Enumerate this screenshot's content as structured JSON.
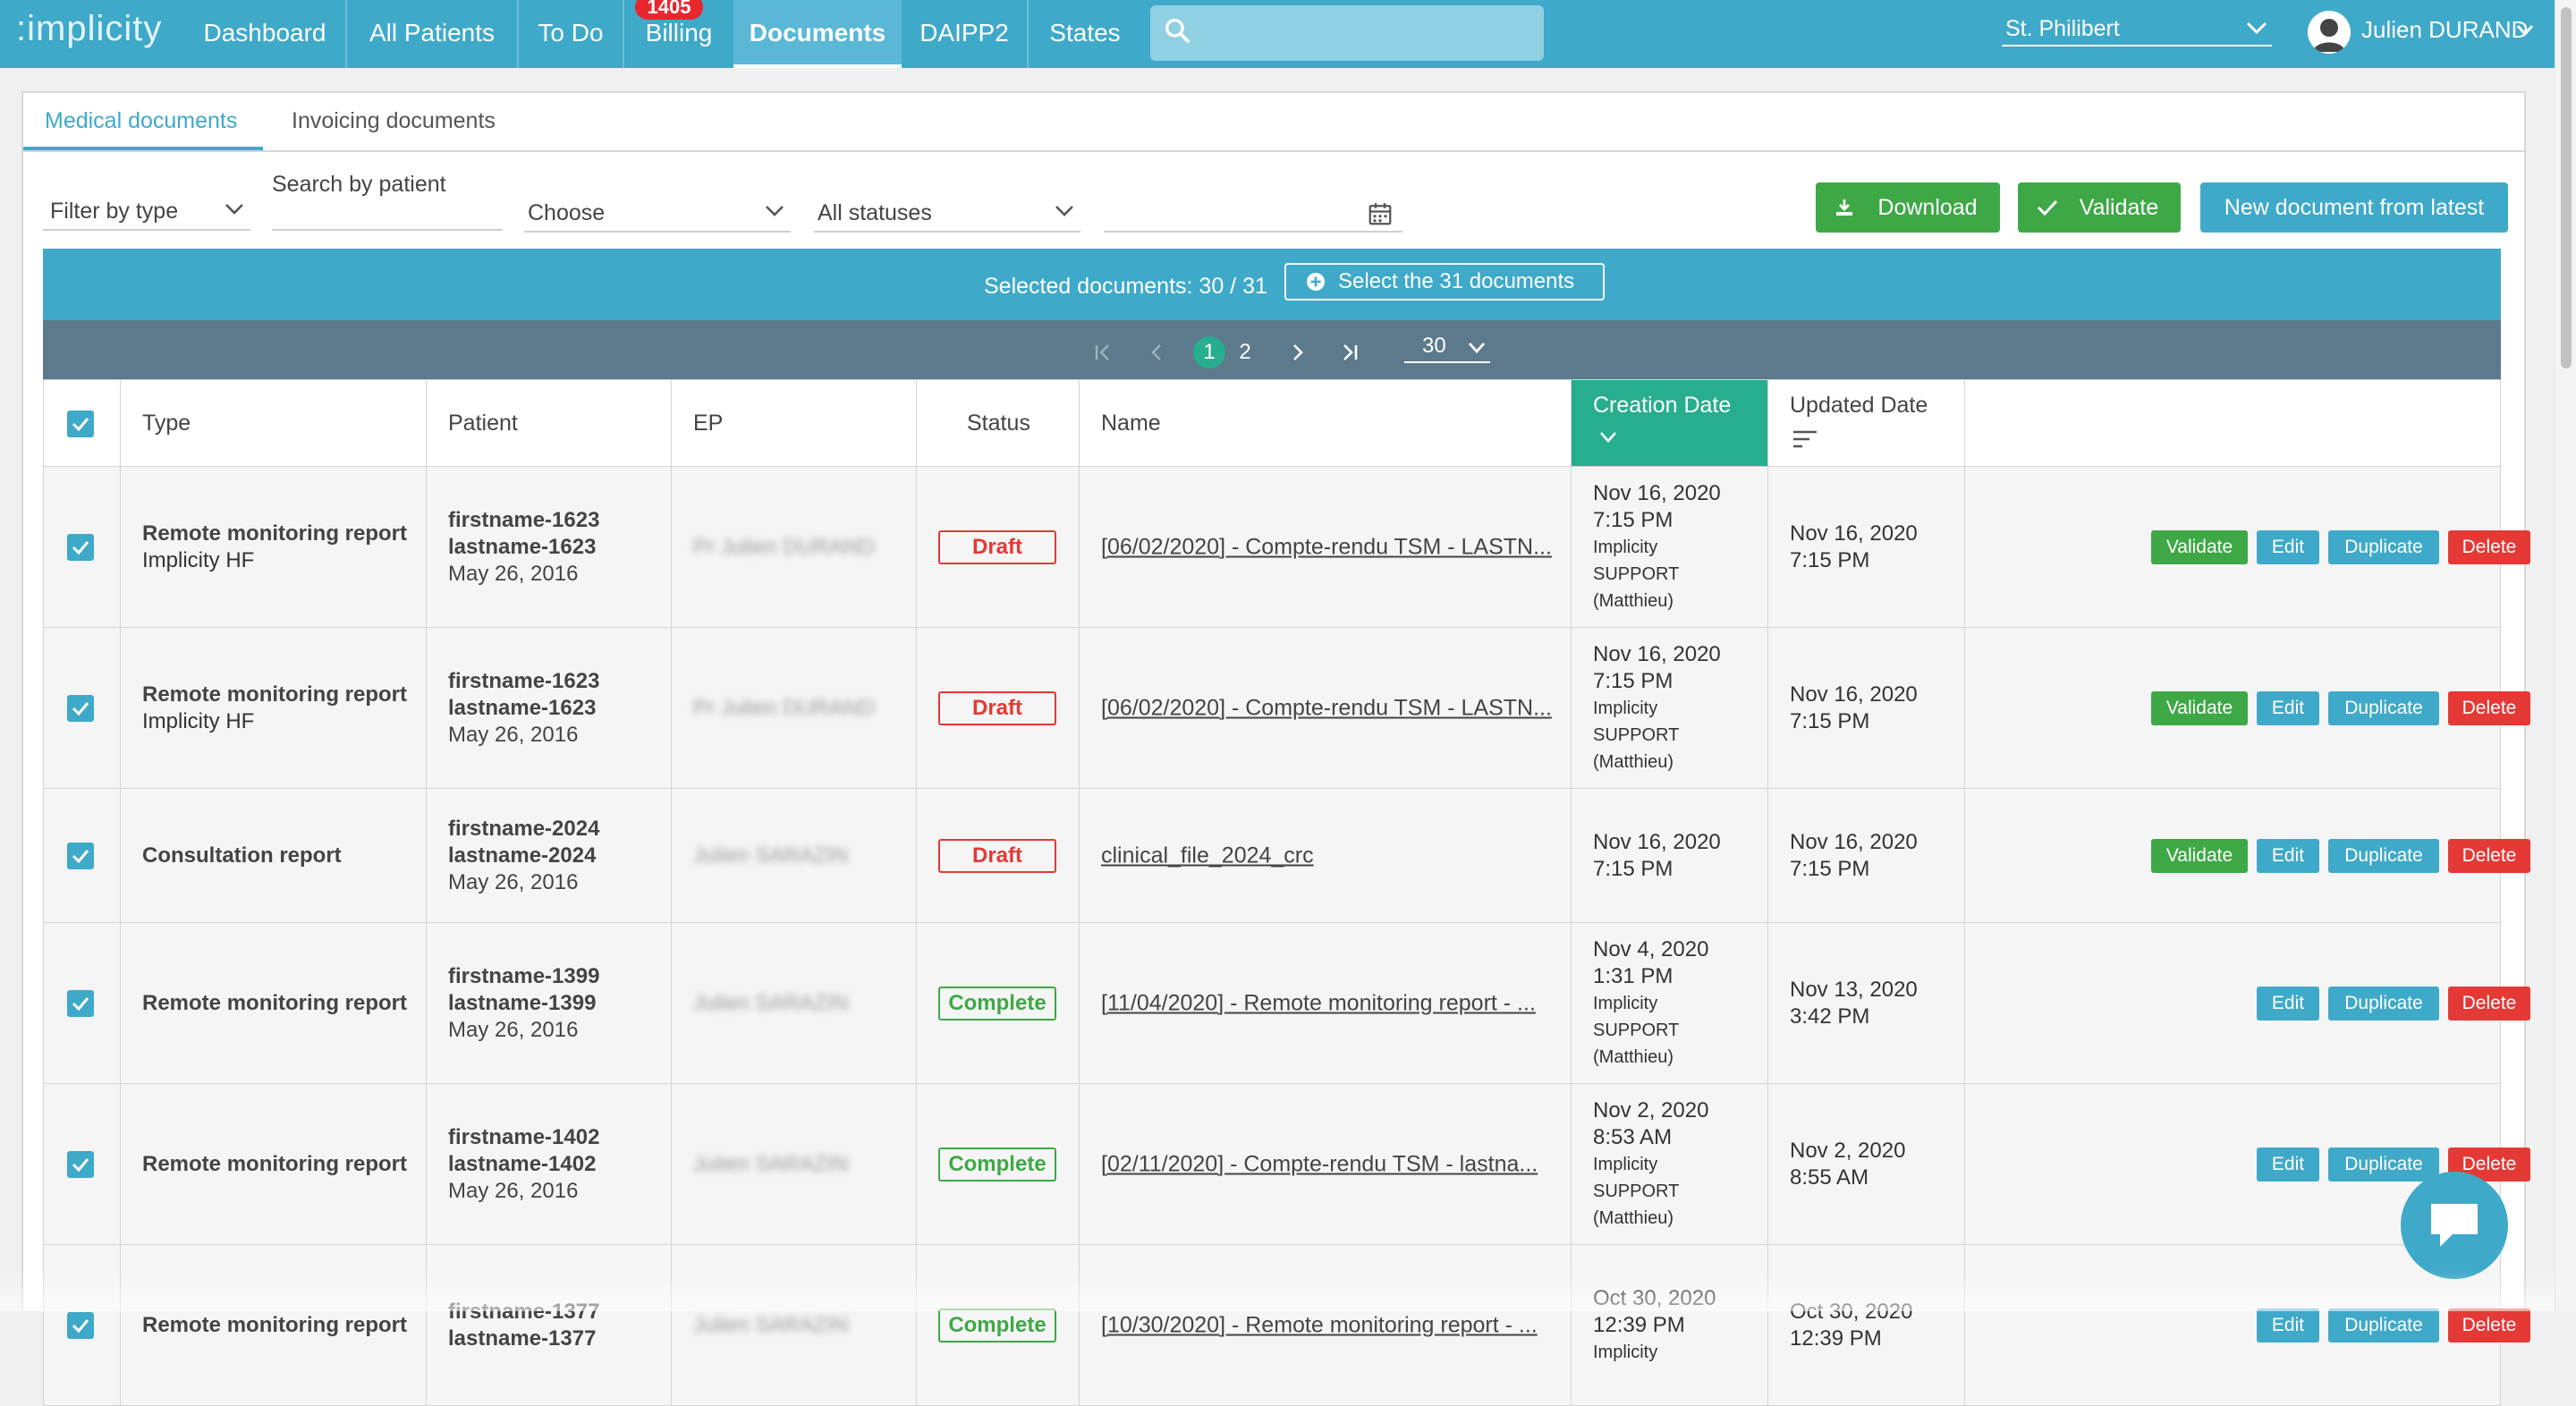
{
  "nav": {
    "logo": ":implicity",
    "items": [
      "Dashboard",
      "All Patients",
      "To Do",
      "Billing",
      "Documents",
      "DAIPP2",
      "States"
    ],
    "billing_badge": "1405",
    "search_placeholder": "",
    "site": "St. Philibert",
    "user": "Julien DURAND",
    "icons": [
      "search-icon",
      "chevron-down-icon",
      "avatar",
      "chevron-down-icon"
    ]
  },
  "tabs": [
    "Medical documents",
    "Invoicing documents"
  ],
  "filters": {
    "type": "Filter by type",
    "patient_label": "Search by patient",
    "patient_value": "",
    "choose": "Choose",
    "statuses": "All statuses",
    "date_value": ""
  },
  "actions": {
    "download": "Download",
    "validate": "Validate",
    "new_document": "New document from latest"
  },
  "selection": {
    "text": "Selected documents: 30 / 31",
    "select_all": "Select the 31 documents"
  },
  "pager": {
    "pages": [
      "1",
      "2"
    ],
    "current": "1",
    "page_size": "30"
  },
  "table": {
    "headers": {
      "type": "Type",
      "patient": "Patient",
      "ep": "EP",
      "status": "Status",
      "name": "Name",
      "creation": "Creation Date",
      "updated": "Updated Date"
    },
    "buttons": {
      "validate": "Validate",
      "edit": "Edit",
      "duplicate": "Duplicate",
      "delete": "Delete"
    },
    "rows": [
      {
        "type": "Remote monitoring report",
        "subtype": "Implicity HF",
        "patient1": "firstname-1623",
        "patient2": "lastname-1623",
        "patient3": "May 26, 2016",
        "ep": "Pr Julien DURAND",
        "status": "Draft",
        "name": "[06/02/2020] - Compte-rendu TSM - LASTN...",
        "created1": "Nov 16, 2020",
        "created2": "7:15 PM",
        "by1": "Implicity",
        "by2": "SUPPORT",
        "by3": "(Matthieu)",
        "updated1": "Nov 16, 2020",
        "updated2": "7:15 PM",
        "validatable": true
      },
      {
        "type": "Remote monitoring report",
        "subtype": "Implicity HF",
        "patient1": "firstname-1623",
        "patient2": "lastname-1623",
        "patient3": "May 26, 2016",
        "ep": "Pr Julien DURAND",
        "status": "Draft",
        "name": "[06/02/2020] - Compte-rendu TSM - LASTN...",
        "created1": "Nov 16, 2020",
        "created2": "7:15 PM",
        "by1": "Implicity",
        "by2": "SUPPORT",
        "by3": "(Matthieu)",
        "updated1": "Nov 16, 2020",
        "updated2": "7:15 PM",
        "validatable": true
      },
      {
        "type": "Consultation report",
        "subtype": "",
        "patient1": "firstname-2024",
        "patient2": "lastname-2024",
        "patient3": "May 26, 2016",
        "ep": "Julien SARAZIN",
        "status": "Draft",
        "name": "clinical_file_2024_crc",
        "created1": "Nov 16, 2020",
        "created2": "7:15 PM",
        "by1": "",
        "by2": "",
        "by3": "",
        "updated1": "Nov 16, 2020",
        "updated2": "7:15 PM",
        "validatable": true
      },
      {
        "type": "Remote monitoring report",
        "subtype": "",
        "patient1": "firstname-1399",
        "patient2": "lastname-1399",
        "patient3": "May 26, 2016",
        "ep": "Julien SARAZIN",
        "status": "Complete",
        "name": "[11/04/2020] - Remote monitoring report - ...",
        "created1": "Nov 4, 2020",
        "created2": "1:31 PM",
        "by1": "Implicity",
        "by2": "SUPPORT",
        "by3": "(Matthieu)",
        "updated1": "Nov 13, 2020",
        "updated2": "3:42 PM",
        "validatable": false
      },
      {
        "type": "Remote monitoring report",
        "subtype": "",
        "patient1": "firstname-1402",
        "patient2": "lastname-1402",
        "patient3": "May 26, 2016",
        "ep": "Julien SARAZIN",
        "status": "Complete",
        "name": "[02/11/2020] - Compte-rendu TSM - lastna...",
        "created1": "Nov 2, 2020",
        "created2": "8:53 AM",
        "by1": "Implicity",
        "by2": "SUPPORT",
        "by3": "(Matthieu)",
        "updated1": "Nov 2, 2020",
        "updated2": "8:55 AM",
        "validatable": false
      },
      {
        "type": "Remote monitoring report",
        "subtype": "",
        "patient1": "firstname-1377",
        "patient2": "lastname-1377",
        "patient3": "",
        "ep": "Julien SARAZIN",
        "status": "Complete",
        "name": "[10/30/2020] - Remote monitoring report - ...",
        "created1": "Oct 30, 2020",
        "created2": "12:39 PM",
        "by1": "Implicity",
        "by2": "",
        "by3": "",
        "updated1": "Oct 30, 2020",
        "updated2": "12:39 PM",
        "validatable": false
      }
    ]
  },
  "colors": {
    "primary": "#3fa9c9",
    "green": "#3ea846",
    "red": "#e53935",
    "sorted_header": "#27ae8f",
    "pager_bar": "#5c7a8b"
  }
}
